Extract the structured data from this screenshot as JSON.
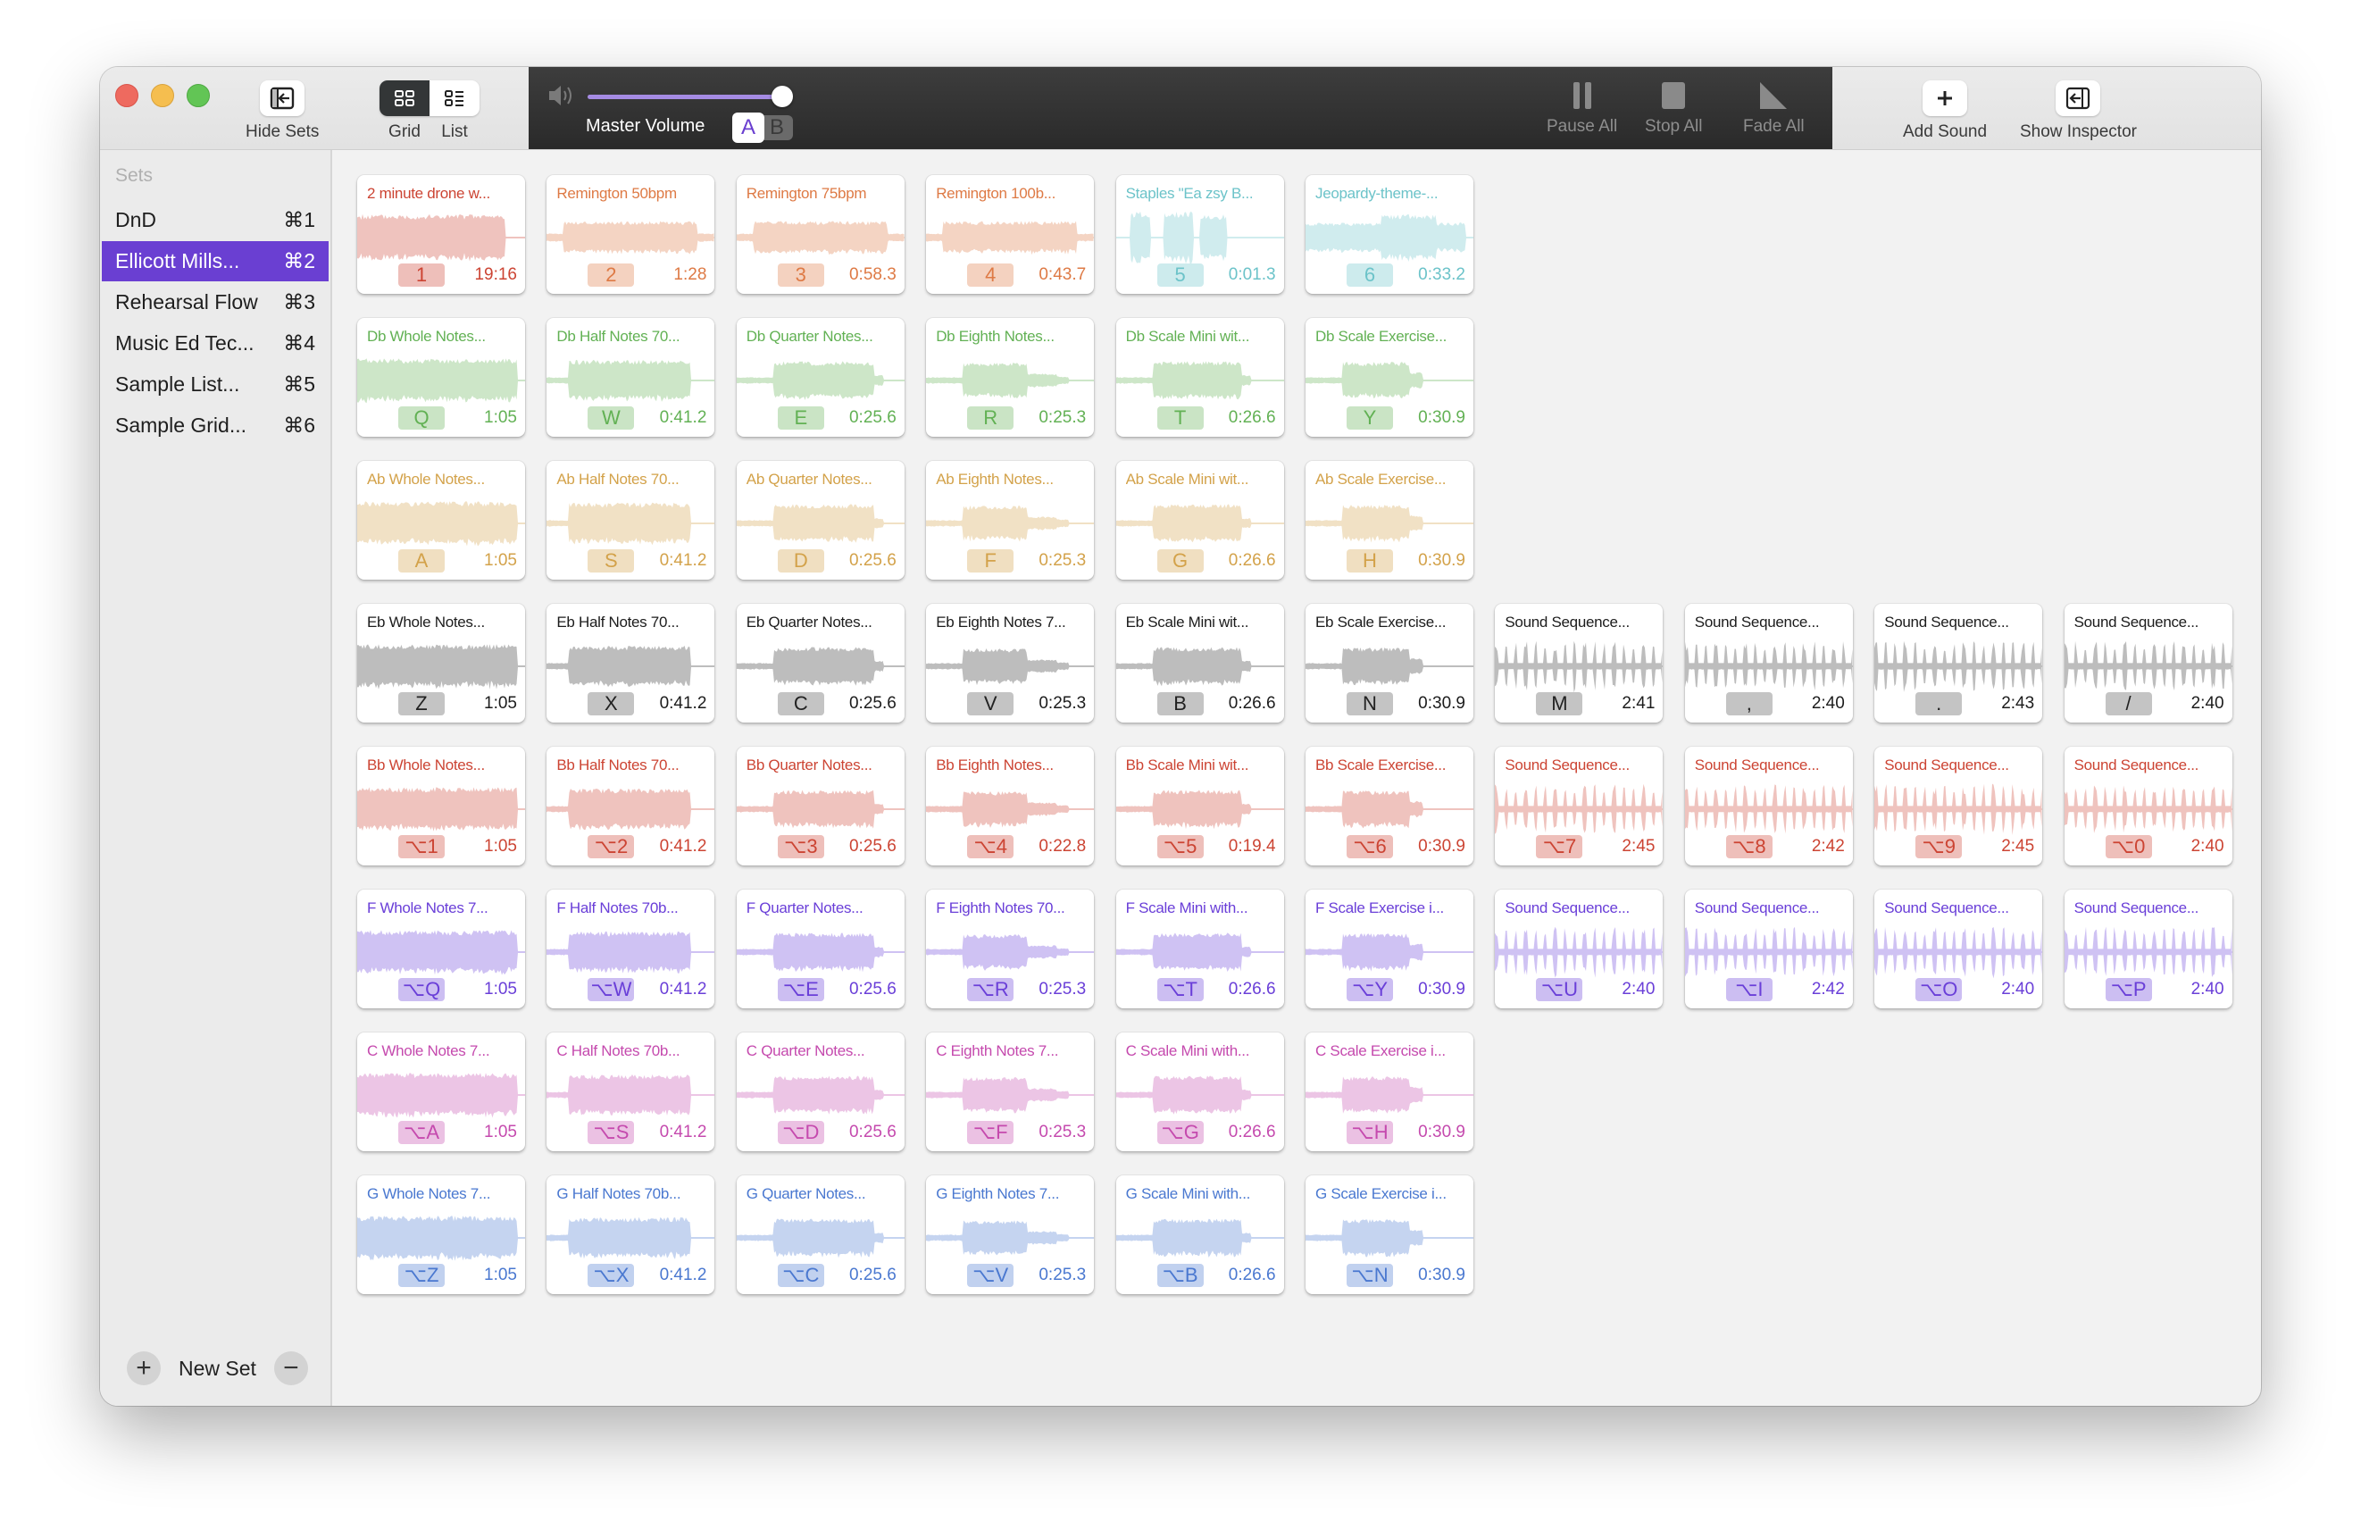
{
  "toolbar": {
    "hide_sets": "Hide Sets",
    "grid": "Grid",
    "list": "List",
    "master_volume": "Master Volume",
    "volume_level": 0.98,
    "bank_a": "A",
    "bank_b": "B",
    "pause_all": "Pause All",
    "stop_all": "Stop All",
    "fade_all": "Fade All",
    "add_sound": "Add Sound",
    "show_inspector": "Show Inspector"
  },
  "colors": {
    "accent": "#6a3fd2",
    "red": "#cc4433",
    "orange": "#de7a45",
    "teal": "#6cc3c9",
    "green": "#62b154",
    "gold": "#d3a24a",
    "black": "#1c1c1c",
    "purple": "#6a3fd8",
    "pink": "#c54aae",
    "blue": "#4a78d0"
  },
  "sidebar": {
    "heading": "Sets",
    "items": [
      {
        "label": "DnD",
        "shortcut": "⌘1",
        "active": false
      },
      {
        "label": "Ellicott Mills...",
        "shortcut": "⌘2",
        "active": true
      },
      {
        "label": "Rehearsal Flow",
        "shortcut": "⌘3",
        "active": false
      },
      {
        "label": "Music Ed Tec...",
        "shortcut": "⌘4",
        "active": false
      },
      {
        "label": "Sample List...",
        "shortcut": "⌘5",
        "active": false
      },
      {
        "label": "Sample Grid...",
        "shortcut": "⌘6",
        "active": false
      }
    ],
    "new_set": "New Set"
  },
  "rows": [
    {
      "color": "red",
      "cards": [
        {
          "title": "2 minute drone w...",
          "key": "1",
          "duration": "19:16",
          "color": "red",
          "wave": "solid"
        },
        {
          "title": "Remington 50bpm",
          "key": "2",
          "duration": "1:28",
          "color": "orange",
          "wave": "long"
        },
        {
          "title": "Remington 75bpm",
          "key": "3",
          "duration": "0:58.3",
          "color": "orange",
          "wave": "long"
        },
        {
          "title": "Remington 100b...",
          "key": "4",
          "duration": "0:43.7",
          "color": "orange",
          "wave": "long"
        },
        {
          "title": "Staples \"Ea zsy B...",
          "key": "5",
          "duration": "0:01.3",
          "color": "teal",
          "wave": "speech"
        },
        {
          "title": "Jeopardy-theme-...",
          "key": "6",
          "duration": "0:33.2",
          "color": "teal",
          "wave": "music"
        }
      ]
    },
    {
      "color": "green",
      "cards": [
        {
          "title": "Db Whole Notes...",
          "key": "Q",
          "duration": "1:05",
          "wave": "whole"
        },
        {
          "title": "Db Half Notes 70...",
          "key": "W",
          "duration": "0:41.2",
          "wave": "half"
        },
        {
          "title": "Db Quarter Notes...",
          "key": "E",
          "duration": "0:25.6",
          "wave": "quarter"
        },
        {
          "title": "Db Eighth Notes...",
          "key": "R",
          "duration": "0:25.3",
          "wave": "eighth"
        },
        {
          "title": "Db Scale Mini wit...",
          "key": "T",
          "duration": "0:26.6",
          "wave": "mini"
        },
        {
          "title": "Db Scale Exercise...",
          "key": "Y",
          "duration": "0:30.9",
          "wave": "exercise"
        }
      ]
    },
    {
      "color": "gold",
      "cards": [
        {
          "title": "Ab Whole Notes...",
          "key": "A",
          "duration": "1:05",
          "wave": "whole"
        },
        {
          "title": "Ab Half Notes 70...",
          "key": "S",
          "duration": "0:41.2",
          "wave": "half"
        },
        {
          "title": "Ab Quarter Notes...",
          "key": "D",
          "duration": "0:25.6",
          "wave": "quarter"
        },
        {
          "title": "Ab Eighth Notes...",
          "key": "F",
          "duration": "0:25.3",
          "wave": "eighth"
        },
        {
          "title": "Ab Scale Mini wit...",
          "key": "G",
          "duration": "0:26.6",
          "wave": "mini"
        },
        {
          "title": "Ab Scale Exercise...",
          "key": "H",
          "duration": "0:30.9",
          "wave": "exercise"
        }
      ]
    },
    {
      "color": "black",
      "cards": [
        {
          "title": "Eb Whole Notes...",
          "key": "Z",
          "duration": "1:05",
          "wave": "whole"
        },
        {
          "title": "Eb Half Notes 70...",
          "key": "X",
          "duration": "0:41.2",
          "wave": "half"
        },
        {
          "title": "Eb Quarter Notes...",
          "key": "C",
          "duration": "0:25.6",
          "wave": "quarter"
        },
        {
          "title": "Eb Eighth Notes 7...",
          "key": "V",
          "duration": "0:25.3",
          "wave": "eighth"
        },
        {
          "title": "Eb Scale Mini wit...",
          "key": "B",
          "duration": "0:26.6",
          "wave": "mini"
        },
        {
          "title": "Eb Scale Exercise...",
          "key": "N",
          "duration": "0:30.9",
          "wave": "exercise"
        },
        {
          "title": "Sound Sequence...",
          "key": "M",
          "duration": "2:41",
          "wave": "seq"
        },
        {
          "title": "Sound Sequence...",
          "key": ",",
          "duration": "2:40",
          "wave": "seq"
        },
        {
          "title": "Sound Sequence...",
          "key": ".",
          "duration": "2:43",
          "wave": "seq"
        },
        {
          "title": "Sound Sequence...",
          "key": "/",
          "duration": "2:40",
          "wave": "seq"
        }
      ]
    },
    {
      "color": "red",
      "cards": [
        {
          "title": "Bb Whole Notes...",
          "key": "⌥1",
          "duration": "1:05",
          "wave": "whole"
        },
        {
          "title": "Bb Half Notes 70...",
          "key": "⌥2",
          "duration": "0:41.2",
          "wave": "half"
        },
        {
          "title": "Bb Quarter Notes...",
          "key": "⌥3",
          "duration": "0:25.6",
          "wave": "quarter"
        },
        {
          "title": "Bb Eighth Notes...",
          "key": "⌥4",
          "duration": "0:22.8",
          "wave": "eighth"
        },
        {
          "title": "Bb Scale Mini wit...",
          "key": "⌥5",
          "duration": "0:19.4",
          "wave": "mini"
        },
        {
          "title": "Bb Scale Exercise...",
          "key": "⌥6",
          "duration": "0:30.9",
          "wave": "exercise"
        },
        {
          "title": "Sound Sequence...",
          "key": "⌥7",
          "duration": "2:45",
          "wave": "seq"
        },
        {
          "title": "Sound Sequence...",
          "key": "⌥8",
          "duration": "2:42",
          "wave": "seq"
        },
        {
          "title": "Sound Sequence...",
          "key": "⌥9",
          "duration": "2:45",
          "wave": "seq"
        },
        {
          "title": "Sound Sequence...",
          "key": "⌥0",
          "duration": "2:40",
          "wave": "seq"
        }
      ]
    },
    {
      "color": "purple",
      "cards": [
        {
          "title": "F Whole Notes 7...",
          "key": "⌥Q",
          "duration": "1:05",
          "wave": "whole"
        },
        {
          "title": "F Half Notes 70b...",
          "key": "⌥W",
          "duration": "0:41.2",
          "wave": "half"
        },
        {
          "title": "F Quarter Notes...",
          "key": "⌥E",
          "duration": "0:25.6",
          "wave": "quarter"
        },
        {
          "title": "F Eighth Notes 70...",
          "key": "⌥R",
          "duration": "0:25.3",
          "wave": "eighth"
        },
        {
          "title": "F Scale Mini with...",
          "key": "⌥T",
          "duration": "0:26.6",
          "wave": "mini"
        },
        {
          "title": "F Scale Exercise i...",
          "key": "⌥Y",
          "duration": "0:30.9",
          "wave": "exercise"
        },
        {
          "title": "Sound Sequence...",
          "key": "⌥U",
          "duration": "2:40",
          "wave": "seq"
        },
        {
          "title": "Sound Sequence...",
          "key": "⌥I",
          "duration": "2:42",
          "wave": "seq"
        },
        {
          "title": "Sound Sequence...",
          "key": "⌥O",
          "duration": "2:40",
          "wave": "seq"
        },
        {
          "title": "Sound Sequence...",
          "key": "⌥P",
          "duration": "2:40",
          "wave": "seq"
        }
      ]
    },
    {
      "color": "pink",
      "cards": [
        {
          "title": "C Whole Notes 7...",
          "key": "⌥A",
          "duration": "1:05",
          "wave": "whole"
        },
        {
          "title": "C Half Notes 70b...",
          "key": "⌥S",
          "duration": "0:41.2",
          "wave": "half"
        },
        {
          "title": "C Quarter Notes...",
          "key": "⌥D",
          "duration": "0:25.6",
          "wave": "quarter"
        },
        {
          "title": "C Eighth Notes 7...",
          "key": "⌥F",
          "duration": "0:25.3",
          "wave": "eighth"
        },
        {
          "title": "C Scale Mini with...",
          "key": "⌥G",
          "duration": "0:26.6",
          "wave": "mini"
        },
        {
          "title": "C Scale Exercise i...",
          "key": "⌥H",
          "duration": "0:30.9",
          "wave": "exercise"
        }
      ]
    },
    {
      "color": "blue",
      "cards": [
        {
          "title": "G Whole Notes 7...",
          "key": "⌥Z",
          "duration": "1:05",
          "wave": "whole"
        },
        {
          "title": "G Half Notes 70b...",
          "key": "⌥X",
          "duration": "0:41.2",
          "wave": "half"
        },
        {
          "title": "G Quarter Notes...",
          "key": "⌥C",
          "duration": "0:25.6",
          "wave": "quarter"
        },
        {
          "title": "G Eighth Notes 7...",
          "key": "⌥V",
          "duration": "0:25.3",
          "wave": "eighth"
        },
        {
          "title": "G Scale Mini with...",
          "key": "⌥B",
          "duration": "0:26.6",
          "wave": "mini"
        },
        {
          "title": "G Scale Exercise i...",
          "key": "⌥N",
          "duration": "0:30.9",
          "wave": "exercise"
        }
      ]
    }
  ]
}
